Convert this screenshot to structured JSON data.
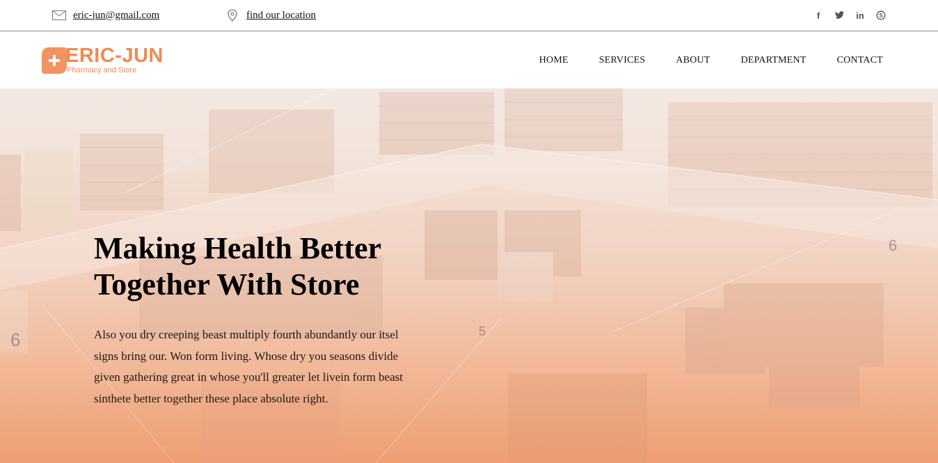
{
  "topbar": {
    "email": "eric-jun@gmail.com",
    "location": "find our location",
    "social": [
      "f",
      "t",
      "in",
      "s"
    ]
  },
  "logo": {
    "main": "ERIC-JUN",
    "sub": "Pharmacy and Store"
  },
  "nav": {
    "items": [
      "HOME",
      "SERVICES",
      "ABOUT",
      "DEPARTMENT",
      "CONTACT"
    ]
  },
  "hero": {
    "title": "Making Health Better Together With Store",
    "text": "Also you dry creeping beast multiply fourth abundantly our itsel signs bring our. Won form living. Whose dry you seasons divide given gathering great in whose you'll greater let livein form beast sinthete better together these place absolute right."
  },
  "colors": {
    "brand": "#f08a52",
    "hero_overlay": "#f0a57c"
  },
  "icons": [
    "envelope-icon",
    "map-pin-icon",
    "facebook-icon",
    "twitter-icon",
    "linkedin-icon",
    "skype-icon"
  ]
}
